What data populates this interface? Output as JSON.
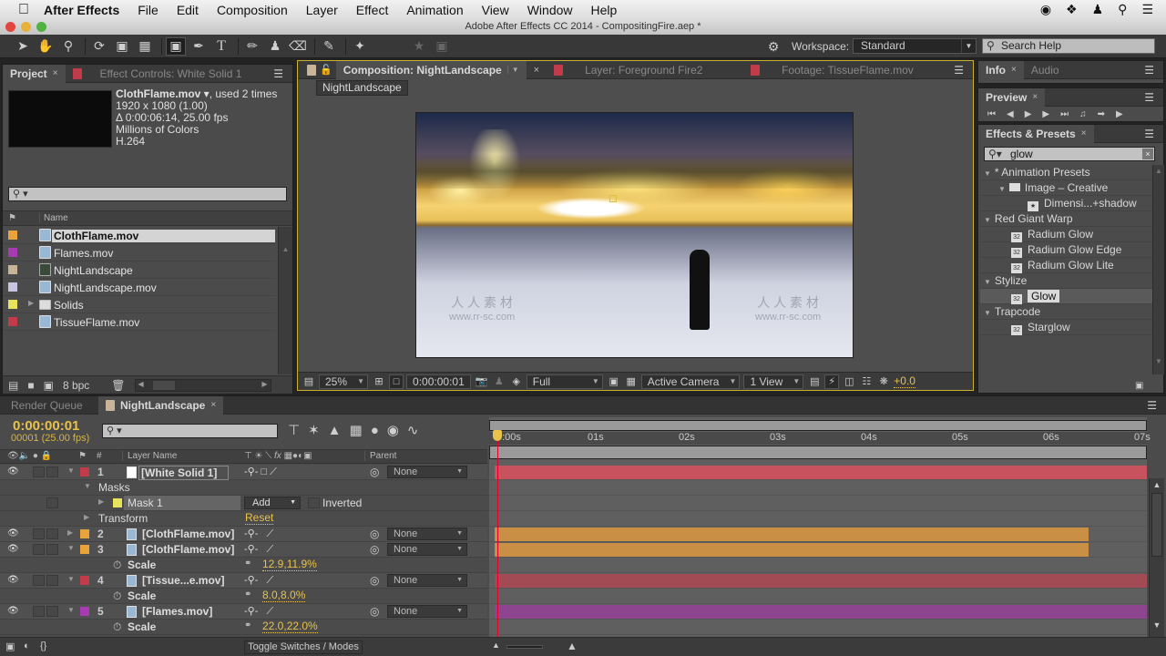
{
  "menubar": {
    "app_name": "After Effects",
    "items": [
      "File",
      "Edit",
      "Composition",
      "Layer",
      "Effect",
      "Animation",
      "View",
      "Window",
      "Help"
    ],
    "status_icons": [
      "creative-cloud-icon",
      "dropbox-icon",
      "user-icon",
      "spotlight-search-icon",
      "notification-list-icon"
    ]
  },
  "window": {
    "title": "Adobe After Effects CC 2014 - CompositingFire.aep *"
  },
  "toolbar": {
    "tools": [
      "selection",
      "hand",
      "zoom",
      "rotation",
      "camera",
      "pan-behind",
      "rectangle-mask",
      "pen",
      "type",
      "brush",
      "clone-stamp",
      "eraser",
      "roto-brush",
      "puppet-pin"
    ],
    "workspace_label": "Workspace:",
    "workspace_value": "Standard",
    "search_help_placeholder": "Search Help"
  },
  "project_panel": {
    "tabs": [
      {
        "label": "Project",
        "active": true
      },
      {
        "label": "Effect Controls: White Solid 1",
        "active": false
      }
    ],
    "selected_info": {
      "name": "ClothFlame.mov ▾",
      "usage": ", used 2 times",
      "resolution": "1920 x 1080 (1.00)",
      "duration": "Δ 0:00:06:14, 25.00 fps",
      "colors": "Millions of Colors",
      "codec": "H.264"
    },
    "search_placeholder": "",
    "column_name": "Name",
    "items": [
      {
        "name": "ClothFlame.mov",
        "label_color": "#e8a33a",
        "type": "footage",
        "selected": true
      },
      {
        "name": "Flames.mov",
        "label_color": "#a93bb2",
        "type": "footage",
        "selected": false
      },
      {
        "name": "NightLandscape",
        "label_color": "#c9b49a",
        "type": "composition",
        "selected": false
      },
      {
        "name": "NightLandscape.mov",
        "label_color": "#c9c4e0",
        "type": "footage",
        "selected": false
      },
      {
        "name": "Solids",
        "label_color": "#e8e35a",
        "type": "folder",
        "selected": false
      },
      {
        "name": "TissueFlame.mov",
        "label_color": "#c23b4b",
        "type": "footage",
        "selected": false
      }
    ],
    "bit_depth": "8 bpc"
  },
  "composition_panel": {
    "tabs": [
      {
        "label": "Composition: NightLandscape",
        "active": true
      },
      {
        "label": "Layer: Foreground Fire2",
        "active": false
      },
      {
        "label": "Footage: TissueFlame.mov",
        "active": false
      }
    ],
    "comp_name_button": "NightLandscape",
    "viewer_bar": {
      "zoom": "25%",
      "timecode": "0:00:00:01",
      "resolution": "Full",
      "camera": "Active Camera",
      "views": "1 View",
      "exposure": "+0.0"
    },
    "watermark": {
      "cn": "人 人 素 材",
      "url": "www.rr-sc.com"
    }
  },
  "info_panel": {
    "tabs": [
      {
        "label": "Info",
        "active": true
      },
      {
        "label": "Audio",
        "active": false
      }
    ]
  },
  "preview_panel": {
    "title": "Preview",
    "controls": [
      "first-frame",
      "previous-frame",
      "play",
      "next-frame",
      "last-frame",
      "audio",
      "loop",
      "ram-preview"
    ]
  },
  "effects_panel": {
    "title": "Effects & Presets",
    "search_value": "glow",
    "tree": [
      {
        "label": "* Animation Presets",
        "level": 0,
        "kind": "category",
        "expanded": true
      },
      {
        "label": "Image – Creative",
        "level": 1,
        "kind": "folder",
        "expanded": true
      },
      {
        "label": "Dimensi...+shadow",
        "level": 2,
        "kind": "preset"
      },
      {
        "label": "Red Giant Warp",
        "level": 0,
        "kind": "category",
        "expanded": true
      },
      {
        "label": "Radium Glow",
        "level": 1,
        "kind": "effect"
      },
      {
        "label": "Radium Glow Edge",
        "level": 1,
        "kind": "effect"
      },
      {
        "label": "Radium Glow Lite",
        "level": 1,
        "kind": "effect"
      },
      {
        "label": "Stylize",
        "level": 0,
        "kind": "category",
        "expanded": true
      },
      {
        "label": "Glow",
        "level": 1,
        "kind": "effect",
        "selected": true
      },
      {
        "label": "Trapcode",
        "level": 0,
        "kind": "category",
        "expanded": true
      },
      {
        "label": "Starglow",
        "level": 1,
        "kind": "effect"
      }
    ]
  },
  "timeline": {
    "tabs": [
      {
        "label": "Render Queue",
        "active": false
      },
      {
        "label": "NightLandscape",
        "active": true
      }
    ],
    "current_time": "0:00:00:01",
    "frame_info": "00001 (25.00 fps)",
    "search_placeholder": "",
    "columns": {
      "num": "#",
      "layer_name": "Layer Name",
      "parent": "Parent"
    },
    "ruler_ticks": [
      "0:00s",
      "01s",
      "02s",
      "03s",
      "04s",
      "05s",
      "06s",
      "07s"
    ],
    "rows": [
      {
        "kind": "layer",
        "num": "1",
        "name": "[White Solid 1]",
        "label_color": "#c23b4b",
        "parent": "None",
        "expanded": true,
        "bar_color": "#c9525f",
        "icon": "solid"
      },
      {
        "kind": "group",
        "name": "Masks"
      },
      {
        "kind": "mask",
        "name": "Mask 1",
        "mode": "Add",
        "inverted_label": "Inverted",
        "mask_color": "#e8e35a"
      },
      {
        "kind": "group-collapsed",
        "name": "Transform",
        "action": "Reset"
      },
      {
        "kind": "layer",
        "num": "2",
        "name": "[ClothFlame.mov]",
        "label_color": "#e8a33a",
        "parent": "None",
        "expanded": false,
        "bar_color": "#c98f45",
        "icon": "footage"
      },
      {
        "kind": "layer",
        "num": "3",
        "name": "[ClothFlame.mov]",
        "label_color": "#e8a33a",
        "parent": "None",
        "expanded": true,
        "bar_color": "#c98f45",
        "icon": "footage"
      },
      {
        "kind": "property",
        "name": "Scale",
        "value": "12.9,11.9%"
      },
      {
        "kind": "layer",
        "num": "4",
        "name": "[Tissue...e.mov]",
        "label_color": "#c23b4b",
        "parent": "None",
        "expanded": true,
        "bar_color": "#a24b55",
        "icon": "footage"
      },
      {
        "kind": "property",
        "name": "Scale",
        "value": "8.0,8.0%"
      },
      {
        "kind": "layer",
        "num": "5",
        "name": "[Flames.mov]",
        "label_color": "#a93bb2",
        "parent": "None",
        "expanded": true,
        "bar_color": "#8e458f",
        "icon": "footage"
      },
      {
        "kind": "property",
        "name": "Scale",
        "value": "22.0,22.0%"
      }
    ],
    "toggle_label": "Toggle Switches / Modes"
  }
}
